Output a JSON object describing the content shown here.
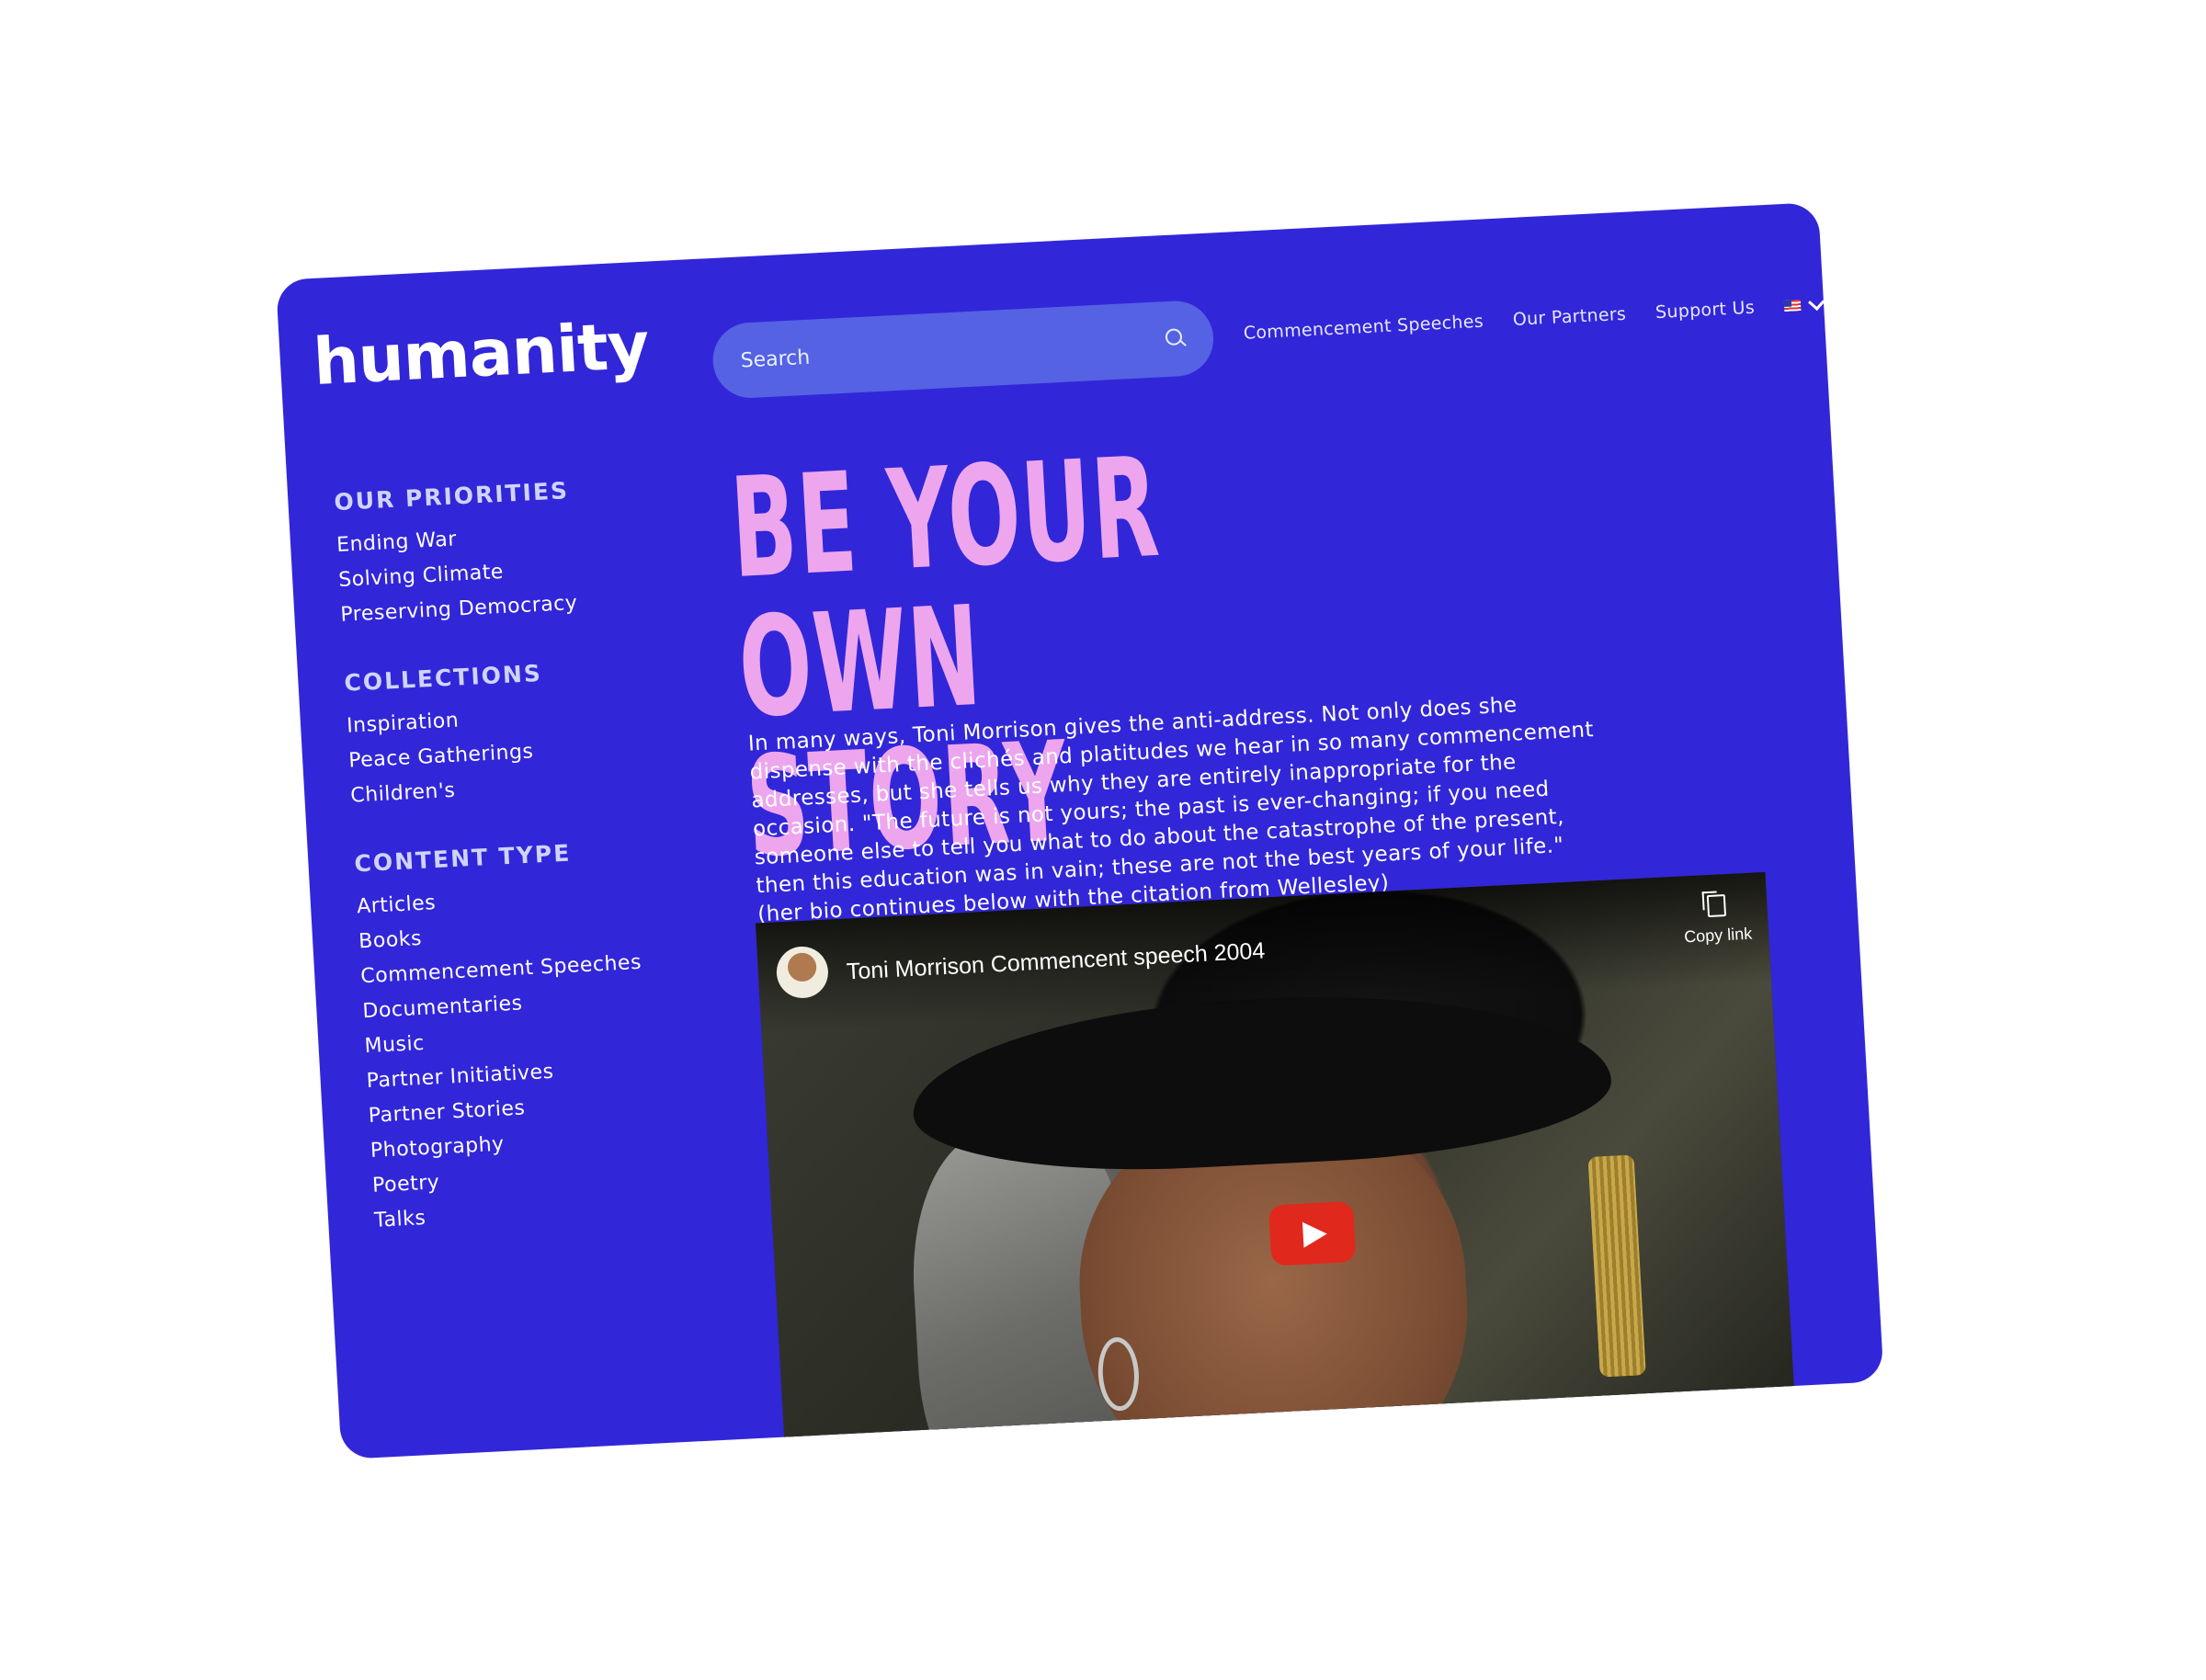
{
  "header": {
    "logo": "humanity",
    "search_placeholder": "Search",
    "nav": [
      "Commencement Speeches",
      "Our Partners",
      "Support Us"
    ]
  },
  "sidebar": {
    "sections": [
      {
        "title": "OUR PRIORITIES",
        "items": [
          "Ending War",
          "Solving Climate",
          "Preserving Democracy"
        ]
      },
      {
        "title": "COLLECTIONS",
        "items": [
          "Inspiration",
          "Peace Gatherings",
          "Children's"
        ]
      },
      {
        "title": "CONTENT TYPE",
        "items": [
          "Articles",
          "Books",
          "Commencement Speeches",
          "Documentaries",
          "Music",
          "Partner Initiatives",
          "Partner Stories",
          "Photography",
          "Poetry",
          "Talks"
        ]
      }
    ]
  },
  "main": {
    "title_line1": "BE YOUR OWN",
    "title_line2": "STORY",
    "intro": "In many ways, Toni Morrison gives the anti-address. Not only does she dispense with the clichés and platitudes we hear in so many commencement addresses, but she tells us why they are entirely inappropriate for the occasion. \"The future is not yours; the past is ever-changing; if you need someone else to tell you what to do about the catastrophe of the present, then this education was in vain; these are not the best years of your life.\" (her bio continues below with the citation from Wellesley)",
    "video": {
      "title": "Toni Morrison Commencent speech 2004",
      "copy_link": "Copy link"
    }
  },
  "colors": {
    "background": "#3226d9",
    "headline": "#eda6ee",
    "search_bg": "#5462e3",
    "play_button": "#e1281d"
  }
}
